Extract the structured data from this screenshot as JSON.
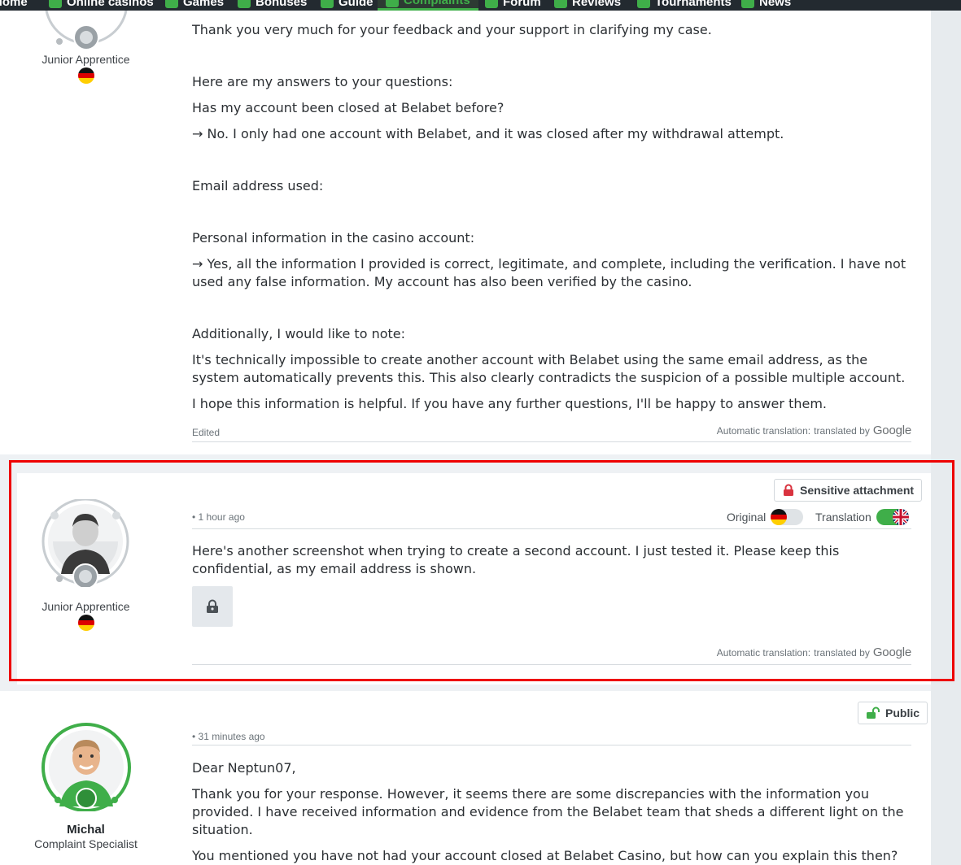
{
  "nav": {
    "items": [
      {
        "label": "Home"
      },
      {
        "label": "Online casinos"
      },
      {
        "label": "Games"
      },
      {
        "label": "Bonuses"
      },
      {
        "label": "Guide"
      },
      {
        "label": "Complaints",
        "active": true
      },
      {
        "label": "Forum"
      },
      {
        "label": "Reviews"
      },
      {
        "label": "Tournaments"
      },
      {
        "label": "News"
      }
    ]
  },
  "post1": {
    "author_rank": "Junior Apprentice",
    "paragraphs": [
      "Thank you very much for your feedback and your support in clarifying my case.",
      "Here are my answers to your questions:",
      "Has my account been closed at Belabet before?",
      "→ No. I only had one account with Belabet, and it was closed after my withdrawal attempt.",
      "Email address used:",
      "Personal information in the casino account:",
      "→ Yes, all the information I provided is correct, legitimate, and complete, including the verification. I have not used any false information. My account has also been verified by the casino.",
      "Additionally, I would like to note:",
      "It's technically impossible to create another account with Belabet using the same email address, as the system automatically prevents this. This also clearly contradicts the suspicion of a possible multiple account.",
      "I hope this information is helpful. If you have any further questions, I'll be happy to answer them."
    ],
    "edited_label": "Edited",
    "translation_note": "Automatic translation:",
    "translated_by": "translated by",
    "google": "Google"
  },
  "post2": {
    "author_rank": "Junior Apprentice",
    "badge": "Sensitive attachment",
    "time": "1 hour ago",
    "original_label": "Original",
    "translation_label": "Translation",
    "text": "Here's another screenshot when trying to create a second account. I just tested it. Please keep this confidential, as my email address is shown.",
    "translation_note": "Automatic translation:",
    "translated_by": "translated by",
    "google": "Google"
  },
  "post3": {
    "author_name": "Michal",
    "author_role": "Complaint Specialist",
    "badge": "Public",
    "time": "31 minutes ago",
    "paragraphs": [
      "Dear Neptun07,",
      "Thank you for your response. However, it seems there are some discrepancies with the information you provided. I have received information and evidence from the Belabet team that sheds a different light on the situation.",
      "You mentioned you have not had your account closed at Belabet Casino, but how can you explain this then?"
    ]
  },
  "colors": {
    "accent_green": "#3fae49",
    "highlight_red": "#e00000",
    "nav_bg": "#232a30"
  }
}
